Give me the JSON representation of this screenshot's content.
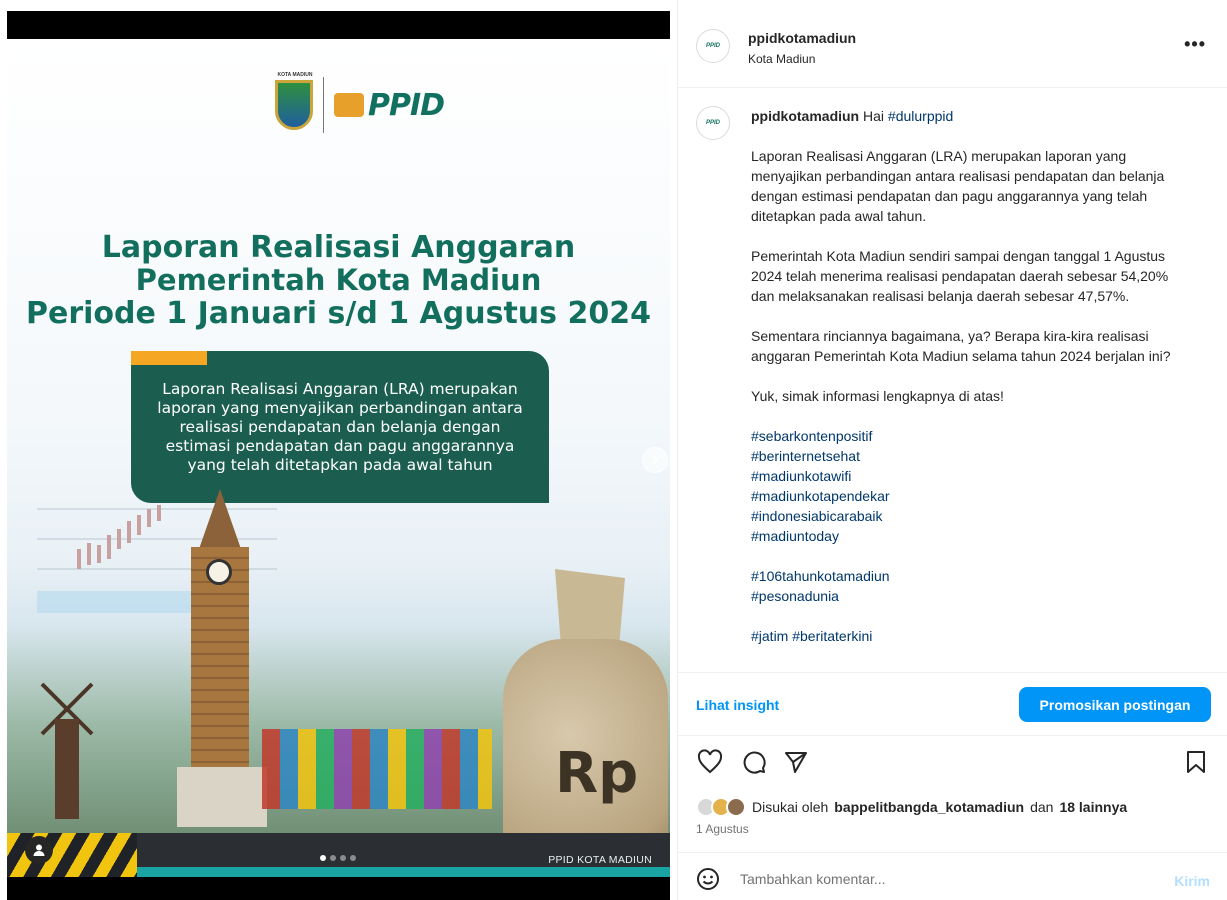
{
  "post_image": {
    "crest_label": "KOTA MADIUN",
    "brand": "PPID",
    "headline": [
      "Laporan Realisasi Anggaran",
      "Pemerintah Kota Madiun",
      "Periode 1 Januari s/d  1 Agustus 2024"
    ],
    "card_text": "Laporan Realisasi Anggaran (LRA) merupakan laporan yang menyajikan perbandingan antara realisasi pendapatan dan belanja dengan estimasi pendapatan dan pagu anggarannya yang telah ditetapkan pada awal tahun",
    "currency": "Rp",
    "watermark": "PPID KOTA MADIUN",
    "carousel": {
      "count": 4,
      "active": 1
    }
  },
  "header": {
    "username": "ppidkotamadiun",
    "location": "Kota Madiun",
    "more": "•••"
  },
  "caption": {
    "username": "ppidkotamadiun",
    "greeting": "Hai",
    "greeting_tag": "#dulurppid",
    "paragraphs": [
      "Laporan Realisasi Anggaran (LRA) merupakan laporan yang menyajikan perbandingan antara realisasi pendapatan dan belanja dengan estimasi pendapatan dan pagu anggarannya yang telah ditetapkan pada awal tahun.",
      "Pemerintah Kota Madiun sendiri sampai dengan tanggal 1 Agustus 2024 telah menerima realisasi pendapatan daerah sebesar 54,20% dan melaksanakan realisasi belanja daerah sebesar 47,57%.",
      "Sementara rinciannya bagaimana, ya? Berapa kira-kira realisasi anggaran Pemerintah Kota Madiun selama tahun 2024 berjalan ini?",
      "Yuk, simak informasi lengkapnya di atas!"
    ],
    "hashtags_1": [
      "#sebarkontenpositif",
      "#berinternetsehat",
      "#madiunkotawifi",
      "#madiunkotapendekar",
      "#indonesiabicarabaik",
      "#madiuntoday"
    ],
    "hashtags_2": [
      "#106tahunkotamadiun",
      "#pesonadunia"
    ],
    "hashtags_3": "#jatim #beritaterkini"
  },
  "insight": {
    "link_label": "Lihat insight",
    "promote_label": "Promosikan postingan"
  },
  "likes": {
    "prefix": "Disukai oleh",
    "user": "bappelitbangda_kotamadiun",
    "joiner": "dan",
    "others": "18 lainnya"
  },
  "date": "1 Agustus",
  "comment": {
    "placeholder": "Tambahkan komentar...",
    "send_label": "Kirim"
  },
  "colors": {
    "accent_blue": "#0095f6",
    "hashtag_blue": "#00376b",
    "ppid_green": "#136f5d",
    "card_green": "#1b5e4f",
    "accent_orange": "#f5a623"
  }
}
